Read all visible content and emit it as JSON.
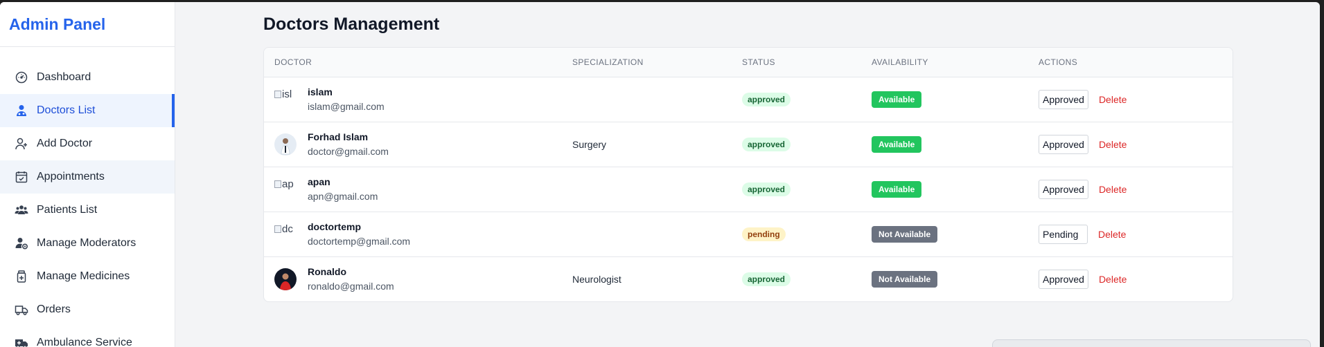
{
  "sidebar": {
    "brand": "Admin Panel",
    "items": [
      {
        "label": "Dashboard",
        "icon": "gauge-icon"
      },
      {
        "label": "Doctors List",
        "icon": "doctor-icon",
        "active": true
      },
      {
        "label": "Add Doctor",
        "icon": "add-user-icon"
      },
      {
        "label": "Appointments",
        "icon": "calendar-check-icon"
      },
      {
        "label": "Patients List",
        "icon": "users-icon"
      },
      {
        "label": "Manage Moderators",
        "icon": "user-gear-icon"
      },
      {
        "label": "Manage Medicines",
        "icon": "medicine-bottle-icon"
      },
      {
        "label": "Orders",
        "icon": "truck-icon"
      },
      {
        "label": "Ambulance Service",
        "icon": "ambulance-icon"
      }
    ]
  },
  "main": {
    "title": "Doctors Management",
    "columns": [
      "DOCTOR",
      "SPECIALIZATION",
      "STATUS",
      "AVAILABILITY",
      "ACTIONS"
    ],
    "rows": [
      {
        "name": "islam",
        "email": "islam@gmail.com",
        "specialization": "",
        "status": "approved",
        "availability": "Available",
        "action": "Approved",
        "delete": "Delete",
        "avatar_alt": "isl"
      },
      {
        "name": "Forhad Islam",
        "email": "doctor@gmail.com",
        "specialization": "Surgery",
        "status": "approved",
        "availability": "Available",
        "action": "Approved",
        "delete": "Delete"
      },
      {
        "name": "apan",
        "email": "apn@gmail.com",
        "specialization": "",
        "status": "approved",
        "availability": "Available",
        "action": "Approved",
        "delete": "Delete",
        "avatar_alt": "ap"
      },
      {
        "name": "doctortemp",
        "email": "doctortemp@gmail.com",
        "specialization": "",
        "status": "pending",
        "availability": "Not Available",
        "action": "Pending",
        "delete": "Delete",
        "avatar_alt": "dc"
      },
      {
        "name": "Ronaldo",
        "email": "ronaldo@gmail.com",
        "specialization": "Neurologist",
        "status": "approved",
        "availability": "Not Available",
        "action": "Approved",
        "delete": "Delete"
      }
    ]
  },
  "colors": {
    "accent": "#2563eb",
    "available": "#22c55e",
    "not_available": "#6b7280",
    "delete": "#dc2626"
  }
}
